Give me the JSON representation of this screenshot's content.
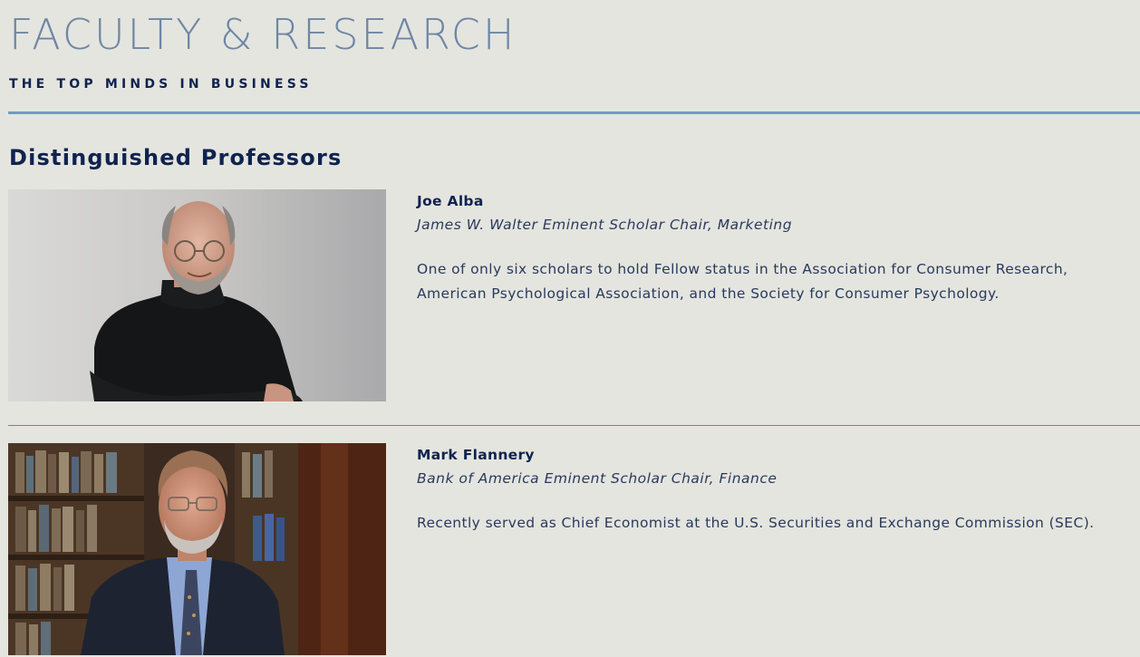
{
  "header": {
    "title": "FACULTY & RESEARCH",
    "subtitle": "THE TOP MINDS IN BUSINESS"
  },
  "section": {
    "heading": "Distinguished Professors"
  },
  "professors": [
    {
      "name": "Joe Alba",
      "title": "James W. Walter Eminent Scholar Chair, Marketing",
      "description": "One of only six scholars to hold Fellow status in the Association for Consumer Research, American Psychological Association, and the Society for Consumer Psychology."
    },
    {
      "name": "Mark Flannery",
      "title": "Bank of America Eminent Scholar Chair, Finance",
      "description": "Recently served as Chief Economist at the U.S. Securities and Exchange Commission (SEC)."
    }
  ],
  "colors": {
    "background": "#e4e5df",
    "title": "#6f86a4",
    "navy": "#0f2350",
    "blue_rule": "#6e9cc6",
    "orange_rule": "#d0673d"
  }
}
